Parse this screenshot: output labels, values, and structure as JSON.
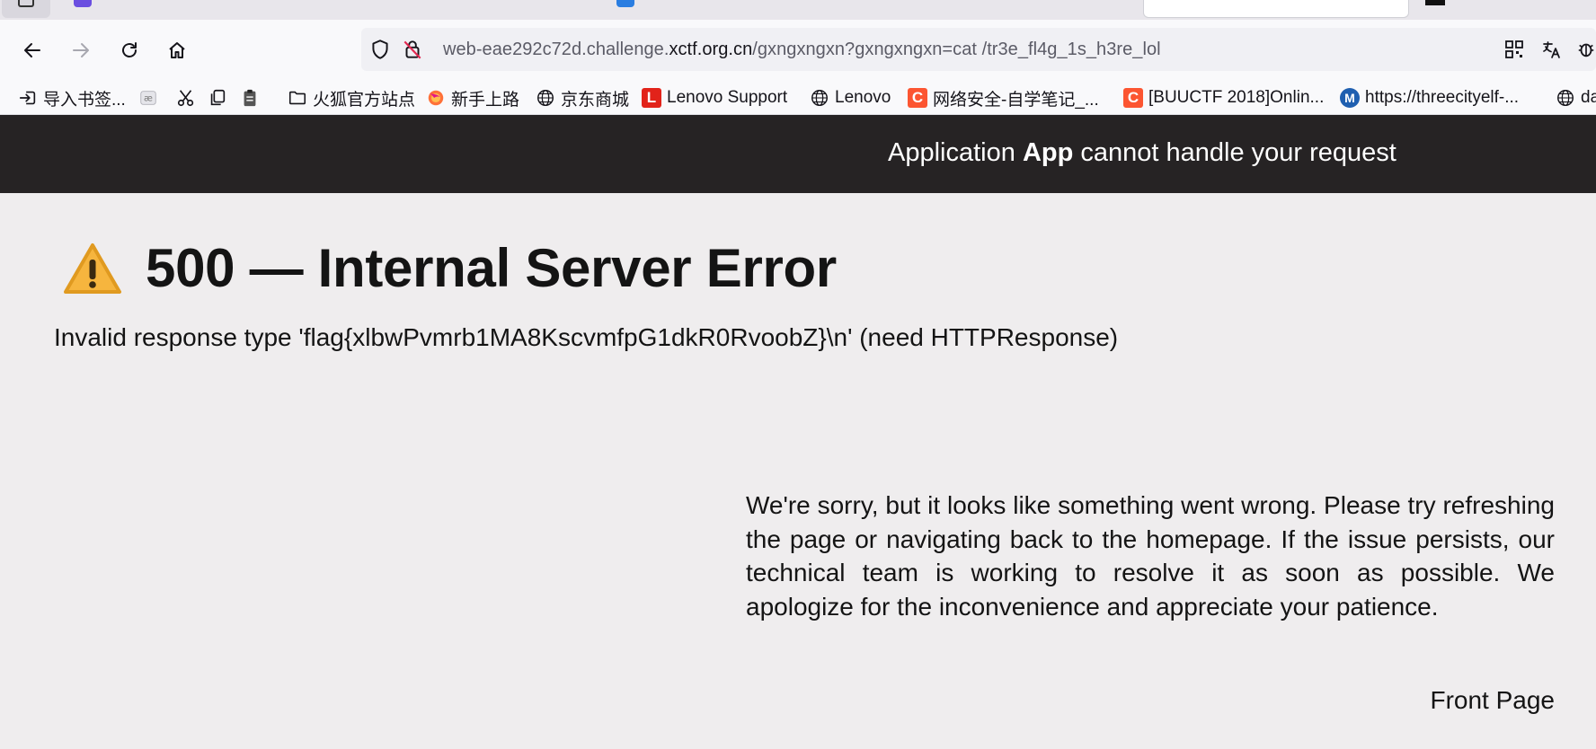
{
  "browser": {
    "url": {
      "prefix": "web-eae292c72d.challenge.",
      "domain": "xctf.org.cn",
      "path": "/gxngxngxn?gxngxngxn=cat /tr3e_fl4g_1s_h3re_lol"
    },
    "bookmarks": [
      {
        "label": "导入书签...",
        "icon": "import-icon"
      },
      {
        "label": "",
        "icon": "notes-icon"
      },
      {
        "label": "",
        "icon": "scissors-icon"
      },
      {
        "label": "",
        "icon": "copy-icon"
      },
      {
        "label": "",
        "icon": "clipboard-icon"
      },
      {
        "label": "火狐官方站点",
        "icon": "folder-icon"
      },
      {
        "label": "新手上路",
        "icon": "firefox-icon"
      },
      {
        "label": "京东商城",
        "icon": "globe-icon"
      },
      {
        "label": "Lenovo Support",
        "icon": "lenovo-l-icon"
      },
      {
        "label": "Lenovo",
        "icon": "globe-icon"
      },
      {
        "label": "网络安全-自学笔记_...",
        "icon": "csdn-icon"
      },
      {
        "label": "[BUUCTF 2018]Onlin...",
        "icon": "csdn-icon"
      },
      {
        "label": "https://threecityelf-...",
        "icon": "m-icon"
      },
      {
        "label": "da",
        "icon": "globe-icon"
      }
    ],
    "colors": {
      "csdn": "#fc5531",
      "lenovo": "#e2231a",
      "m_blue": "#1f5fb0"
    }
  },
  "app": {
    "header_pre": "Application ",
    "header_app": "App",
    "header_post": " cannot handle your request",
    "header_bg": "#262324"
  },
  "error": {
    "title": "500 — Internal Server Error",
    "detail": "Invalid response type 'flag{xlbwPvmrb1MA8KscvmfpG1dkR0RvoobZ}\\n' (need HTTPResponse)",
    "message": "We're sorry, but it looks like something went wrong. Please try refreshing the page or navigating back to the homepage. If the issue persists, our technical team is working to resolve it as soon as possible. We apologize for the inconvenience and appreciate your patience.",
    "front_page": "Front Page"
  }
}
